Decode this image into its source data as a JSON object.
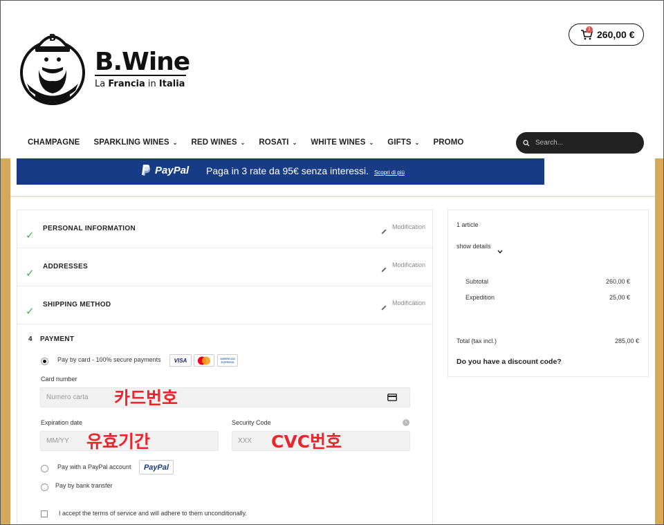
{
  "header": {
    "brand_name": "B.Wine",
    "brand_tag_1": "La",
    "brand_tag_2": "Francia",
    "brand_tag_3": "in",
    "brand_tag_4": "Italia",
    "logo_cap_letter": "B",
    "cart_count": "1",
    "cart_total": "260,00 €"
  },
  "nav": {
    "items": [
      {
        "label": "CHAMPAGNE",
        "has_dropdown": false
      },
      {
        "label": "SPARKLING WINES",
        "has_dropdown": true
      },
      {
        "label": "RED WINES",
        "has_dropdown": true
      },
      {
        "label": "ROSATI",
        "has_dropdown": true
      },
      {
        "label": "WHITE WINES",
        "has_dropdown": true
      },
      {
        "label": "GIFTS",
        "has_dropdown": true
      },
      {
        "label": "PROMO",
        "has_dropdown": false
      }
    ],
    "search_placeholder": "Search..."
  },
  "banner": {
    "paypal_logo": "PayPal",
    "message": "Paga in 3 rate da 95€ senza interessi.",
    "link": "Scopri di più"
  },
  "steps": [
    {
      "title": "PERSONAL INFORMATION",
      "action": "Modification"
    },
    {
      "title": "ADDRESSES",
      "action": "Modification"
    },
    {
      "title": "SHIPPING METHOD",
      "action": "Modification"
    }
  ],
  "payment": {
    "step_number": "4",
    "title": "PAYMENT",
    "card_option_label": "Pay by card - 100% secure payments",
    "card_logos": [
      "VISA",
      "Mastercard",
      "AMERICAN EXPRESS"
    ],
    "card_number_label": "Card number",
    "card_number_placeholder": "Numero carta",
    "card_number_note": "카드번호",
    "expiration_label": "Expiration date",
    "expiration_placeholder": "MM/YY",
    "expiration_note": "유효기간",
    "security_label": "Security Code",
    "security_placeholder": "XXX",
    "security_note": "CVC번호",
    "paypal_option_label": "Pay with a PayPal account",
    "paypal_badge": "PayPal",
    "bank_option_label": "Pay by bank transfer",
    "terms_label": "I accept the terms of service and will adhere to them unconditionally."
  },
  "summary": {
    "article_count": "1 article",
    "show_details": "show details",
    "subtotal_label": "Subtotal",
    "subtotal_value": "260,00 €",
    "expedition_label": "Expedition",
    "expedition_value": "25,00 €",
    "total_label": "Total (tax incl.)",
    "total_value": "285,00 €",
    "discount_label": "Do you have a discount code?"
  },
  "colors": {
    "accent_gold": "#d6a85c",
    "paypal_blue": "#173c85",
    "note_red": "#e8262c",
    "check_green": "#4caf50"
  }
}
